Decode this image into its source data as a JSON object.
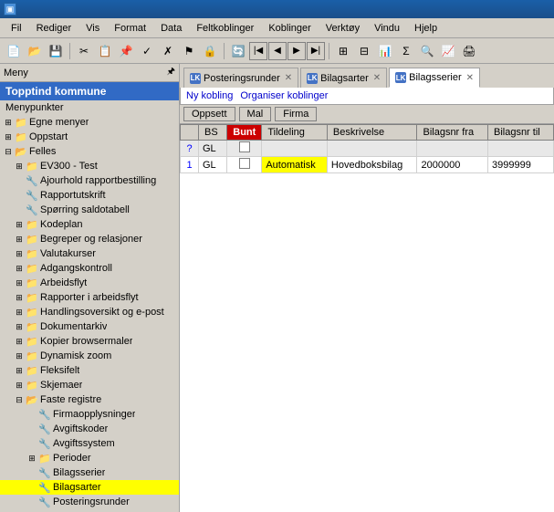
{
  "titlebar": {
    "label": "▣"
  },
  "menubar": {
    "items": [
      "Fil",
      "Rediger",
      "Vis",
      "Format",
      "Data",
      "Feltkoblinger",
      "Koblinger",
      "Verktøy",
      "Vindu",
      "Hjelp"
    ]
  },
  "sidebar": {
    "header": "Meny",
    "pin": "🖈",
    "company": "Topptind kommune",
    "section_label": "Menypunkter",
    "tree": [
      {
        "id": "egne-menyer",
        "label": "Egne menyer",
        "level": 0,
        "type": "folder",
        "expanded": false
      },
      {
        "id": "oppstart",
        "label": "Oppstart",
        "level": 0,
        "type": "folder",
        "expanded": false
      },
      {
        "id": "felles",
        "label": "Felles",
        "level": 0,
        "type": "folder",
        "expanded": true
      },
      {
        "id": "ev300",
        "label": "EV300 - Test",
        "level": 1,
        "type": "folder",
        "expanded": false
      },
      {
        "id": "ajourhold",
        "label": "Ajourhold rapportbestilling",
        "level": 1,
        "type": "item",
        "expanded": false
      },
      {
        "id": "rapportutskrift",
        "label": "Rapportutskrift",
        "level": 1,
        "type": "item"
      },
      {
        "id": "sporing",
        "label": "Spørring saldotabell",
        "level": 1,
        "type": "item"
      },
      {
        "id": "kodeplan",
        "label": "Kodeplan",
        "level": 1,
        "type": "folder"
      },
      {
        "id": "begreper",
        "label": "Begreper og relasjoner",
        "level": 1,
        "type": "folder"
      },
      {
        "id": "valutakurser",
        "label": "Valutakurser",
        "level": 1,
        "type": "folder"
      },
      {
        "id": "adgangskontroll",
        "label": "Adgangskontroll",
        "level": 1,
        "type": "folder"
      },
      {
        "id": "arbeidsflyt",
        "label": "Arbeidsflyt",
        "level": 1,
        "type": "folder"
      },
      {
        "id": "rapporter-arbeidsflyt",
        "label": "Rapporter i arbeidsflyt",
        "level": 1,
        "type": "folder"
      },
      {
        "id": "handlingsoversikt",
        "label": "Handlingsoversikt og e-post",
        "level": 1,
        "type": "folder"
      },
      {
        "id": "dokumentarkiv",
        "label": "Dokumentarkiv",
        "level": 1,
        "type": "folder"
      },
      {
        "id": "kopier-browsermaler",
        "label": "Kopier browsermaler",
        "level": 1,
        "type": "folder"
      },
      {
        "id": "dynamisk-zoom",
        "label": "Dynamisk zoom",
        "level": 1,
        "type": "folder"
      },
      {
        "id": "fleksifelt",
        "label": "Fleksifelt",
        "level": 1,
        "type": "folder"
      },
      {
        "id": "skjemaer",
        "label": "Skjemaer",
        "level": 1,
        "type": "folder"
      },
      {
        "id": "faste-registre",
        "label": "Faste registre",
        "level": 1,
        "type": "folder",
        "expanded": true
      },
      {
        "id": "firmaopplysninger",
        "label": "Firmaopplysninger",
        "level": 2,
        "type": "item"
      },
      {
        "id": "avgiftskoder",
        "label": "Avgiftskoder",
        "level": 2,
        "type": "item"
      },
      {
        "id": "avgiftssystem",
        "label": "Avgiftssystem",
        "level": 2,
        "type": "item"
      },
      {
        "id": "perioder",
        "label": "Perioder",
        "level": 2,
        "type": "folder"
      },
      {
        "id": "bilagsserier",
        "label": "Bilagsserier",
        "level": 2,
        "type": "item"
      },
      {
        "id": "bilagsarter",
        "label": "Bilagsarter",
        "level": 2,
        "type": "item",
        "highlighted": true
      },
      {
        "id": "posteringsrunder",
        "label": "Posteringsrunder",
        "level": 2,
        "type": "item"
      }
    ]
  },
  "tabs": [
    {
      "id": "posteringsrunder",
      "label": "Posteringsrunder",
      "color": "#4472c4",
      "color_label": "LK",
      "active": false,
      "closeable": true
    },
    {
      "id": "bilagsarter",
      "label": "Bilagsarter",
      "color": "#4472c4",
      "color_label": "LK",
      "active": false,
      "closeable": true
    },
    {
      "id": "bilagsserier",
      "label": "Bilagsserier",
      "color": "#4472c4",
      "color_label": "LK",
      "active": true,
      "closeable": true
    }
  ],
  "action_bar": {
    "links": [
      "Ny kobling",
      "Organiser koblinger"
    ]
  },
  "sub_toolbar": {
    "buttons": [
      "Oppsett",
      "Mal",
      "Firma"
    ]
  },
  "table": {
    "columns": [
      "BS",
      "Bunt",
      "Tildeling",
      "Beskrivelse",
      "Bilagsnr fra",
      "Bilagsnr til"
    ],
    "rows": [
      {
        "indicator": "?",
        "bs": "GL",
        "bunt": "",
        "tildeling": "",
        "beskrivelse": "",
        "fra": "",
        "til": "",
        "new_row": true
      },
      {
        "indicator": "1",
        "bs": "GL",
        "bunt": "",
        "tildeling": "Automatisk",
        "beskrivelse": "Hovedboksbilag",
        "fra": "2000000",
        "til": "3999999",
        "new_row": false
      }
    ]
  }
}
